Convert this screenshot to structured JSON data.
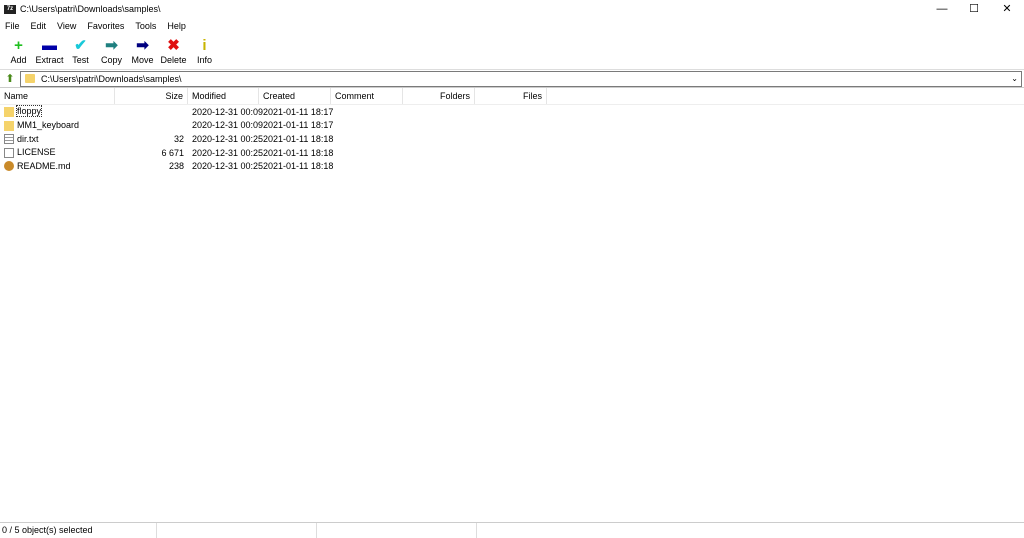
{
  "window": {
    "title": "C:\\Users\\patri\\Downloads\\samples\\",
    "icon": "7z",
    "minimize": "—",
    "maximize": "☐",
    "close": "✕"
  },
  "menu": [
    "File",
    "Edit",
    "View",
    "Favorites",
    "Tools",
    "Help"
  ],
  "toolbar": [
    {
      "label": "Add",
      "icon": "+",
      "color": "#1fbf1f"
    },
    {
      "label": "Extract",
      "icon": "▬",
      "color": "#0000a8"
    },
    {
      "label": "Test",
      "icon": "✔",
      "color": "#19c9d9"
    },
    {
      "label": "Copy",
      "icon": "➡",
      "color": "#1f8080"
    },
    {
      "label": "Move",
      "icon": "➡",
      "color": "#000080"
    },
    {
      "label": "Delete",
      "icon": "✖",
      "color": "#e01010"
    },
    {
      "label": "Info",
      "icon": "i",
      "color": "#c8b400"
    }
  ],
  "address": {
    "path": "C:\\Users\\patri\\Downloads\\samples\\"
  },
  "columns": [
    "Name",
    "Size",
    "Modified",
    "Created",
    "Comment",
    "Folders",
    "Files"
  ],
  "files": [
    {
      "name": "floppy",
      "type": "folder",
      "size": "",
      "modified": "2020-12-31 00:09",
      "created": "2021-01-11 18:17"
    },
    {
      "name": "MM1_keyboard",
      "type": "folder",
      "size": "",
      "modified": "2020-12-31 00:09",
      "created": "2021-01-11 18:17"
    },
    {
      "name": "dir.txt",
      "type": "text",
      "size": "32",
      "modified": "2020-12-31 00:25",
      "created": "2021-01-11 18:18"
    },
    {
      "name": "LICENSE",
      "type": "file",
      "size": "6 671",
      "modified": "2020-12-31 00:25",
      "created": "2021-01-11 18:18"
    },
    {
      "name": "README.md",
      "type": "md",
      "size": "238",
      "modified": "2020-12-31 00:25",
      "created": "2021-01-11 18:18"
    }
  ],
  "status": {
    "selection": "0 / 5 object(s) selected"
  }
}
